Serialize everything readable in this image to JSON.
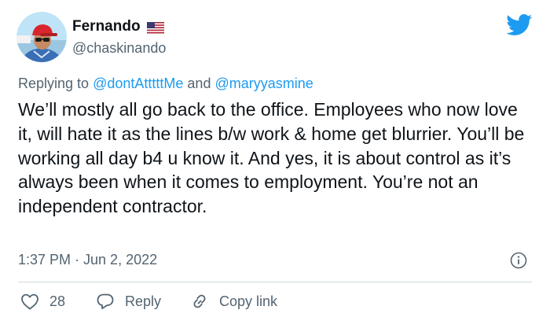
{
  "author": {
    "display_name": "Fernando",
    "handle": "@chaskinando"
  },
  "replying": {
    "prefix": "Replying to",
    "mention1": "@dontAtttttMe",
    "conjunction": "and",
    "mention2": "@maryyasmine"
  },
  "body": "We’ll mostly all go back to the office. Employees who now love it, will hate it as the lines b/w work & home get blurrier. You’ll be working all day b4 u know it. And yes, it is about control as it’s always been when it comes to employment. You’re not an independent contractor.",
  "timestamp": "1:37 PM · Jun 2, 2022",
  "actions": {
    "like_count": "28",
    "reply_label": "Reply",
    "copy_link_label": "Copy link"
  },
  "icons": {
    "bird": "twitter-bird-icon",
    "flag": "us-flag-icon",
    "info": "info-icon",
    "like": "heart-icon",
    "reply": "speech-bubble-icon",
    "copy": "link-icon"
  },
  "colors": {
    "accent": "#1d9bf0",
    "text": "#0f1419",
    "secondary": "#536471",
    "divider": "#cfd9de"
  }
}
